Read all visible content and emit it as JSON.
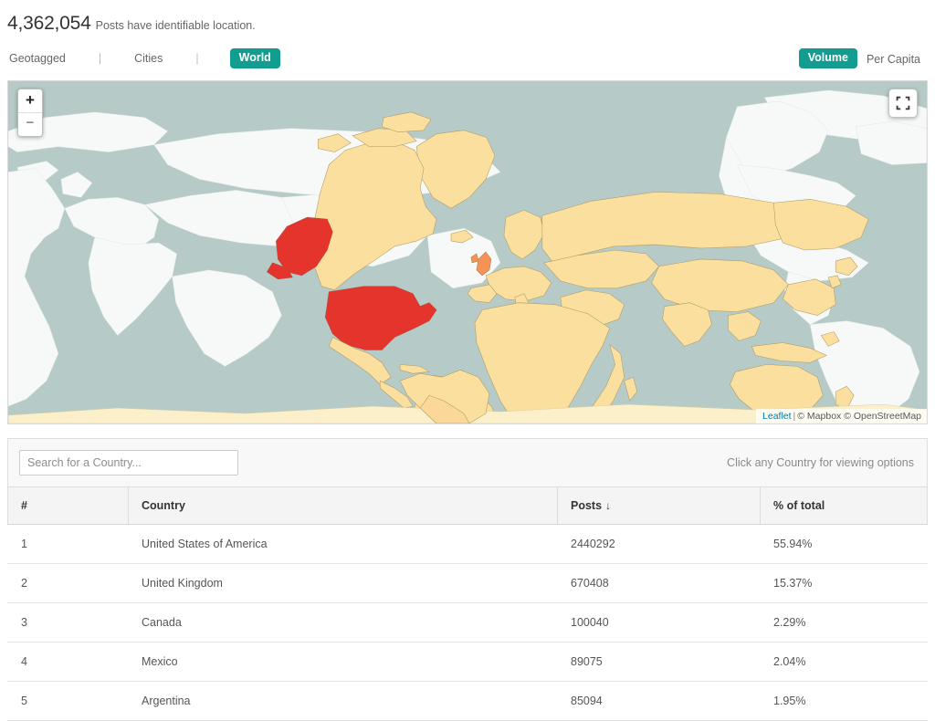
{
  "header": {
    "count": "4,362,054",
    "caption": "Posts have identifiable location."
  },
  "tabs": {
    "left": [
      {
        "label": "Geotagged",
        "active": false
      },
      {
        "label": "Cities",
        "active": false
      },
      {
        "label": "World",
        "active": true
      }
    ],
    "separator": "|",
    "right": [
      {
        "label": "Volume",
        "active": true
      },
      {
        "label": "Per Capita",
        "active": false
      }
    ]
  },
  "map": {
    "zoom_in_label": "+",
    "zoom_out_label": "−",
    "fullscreen_icon": "fullscreen-icon",
    "attribution": {
      "leaflet": "Leaflet",
      "separator": "|",
      "mapbox": "© Mapbox",
      "osm": "© OpenStreetMap"
    },
    "colors": {
      "ocean": "#b6cbc7",
      "land_default": "#fadf9e",
      "rank1": "#e5342c",
      "rank2": "#f59255",
      "rank_low": "#fbe4ae",
      "wrap_land": "#f7f9f8",
      "border": "#b09a63"
    },
    "highlights": [
      {
        "country": "United States of America",
        "color": "#e5342c"
      },
      {
        "country": "United Kingdom",
        "color": "#f59255"
      },
      {
        "country": "Canada",
        "color": "#fadf9e"
      },
      {
        "country": "Mexico",
        "color": "#fadf9e"
      },
      {
        "country": "Argentina",
        "color": "#fbd89a"
      }
    ]
  },
  "search": {
    "placeholder": "Search for a Country...",
    "value": "",
    "hint": "Click any Country for viewing options"
  },
  "table": {
    "columns": [
      {
        "key": "rank",
        "label": "#"
      },
      {
        "key": "country",
        "label": "Country"
      },
      {
        "key": "posts",
        "label": "Posts",
        "sort": "↓"
      },
      {
        "key": "pct",
        "label": "% of total"
      }
    ],
    "rows": [
      {
        "rank": "1",
        "country": "United States of America",
        "posts": "2440292",
        "pct": "55.94%"
      },
      {
        "rank": "2",
        "country": "United Kingdom",
        "posts": "670408",
        "pct": "15.37%"
      },
      {
        "rank": "3",
        "country": "Canada",
        "posts": "100040",
        "pct": "2.29%"
      },
      {
        "rank": "4",
        "country": "Mexico",
        "posts": "89075",
        "pct": "2.04%"
      },
      {
        "rank": "5",
        "country": "Argentina",
        "posts": "85094",
        "pct": "1.95%"
      }
    ]
  }
}
